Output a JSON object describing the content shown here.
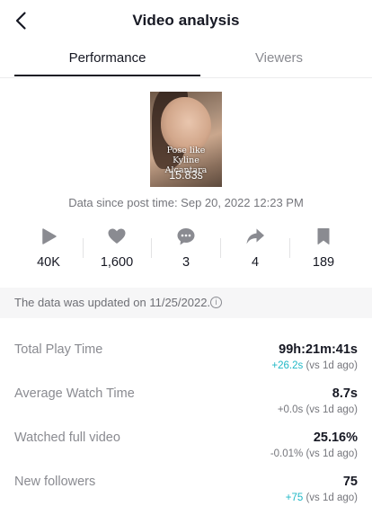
{
  "header": {
    "title": "Video analysis",
    "back_icon": "chevron-left-icon"
  },
  "tabs": [
    {
      "label": "Performance",
      "active": true
    },
    {
      "label": "Viewers",
      "active": false
    }
  ],
  "video": {
    "caption": "Pose like Kyline Alcantara",
    "duration": "15.83s"
  },
  "since_text": "Data since post time: Sep 20, 2022 12:23 PM",
  "stats": [
    {
      "icon": "play-icon",
      "value": "40K"
    },
    {
      "icon": "heart-icon",
      "value": "1,600"
    },
    {
      "icon": "comment-icon",
      "value": "3"
    },
    {
      "icon": "share-icon",
      "value": "4"
    },
    {
      "icon": "bookmark-icon",
      "value": "189"
    }
  ],
  "notice": {
    "text": "The data was updated on 11/25/2022.",
    "icon": "info-icon"
  },
  "metrics": [
    {
      "label": "Total Play Time",
      "value": "99h:21m:41s",
      "delta": "+26.2s",
      "delta_suffix": " (vs 1d ago)"
    },
    {
      "label": "Average Watch Time",
      "value": "8.7s",
      "delta": "+0.0s",
      "delta_suffix": " (vs 1d ago)"
    },
    {
      "label": "Watched full video",
      "value": "25.16%",
      "delta": "-0.01%",
      "delta_suffix": " (vs 1d ago)"
    },
    {
      "label": "New followers",
      "value": "75",
      "delta": "+75",
      "delta_suffix": " (vs 1d ago)"
    }
  ],
  "colors": {
    "accent": "#20b8c6",
    "text_primary": "#161823",
    "text_secondary": "#8a8b91",
    "icon_gray": "#8a8b91"
  }
}
